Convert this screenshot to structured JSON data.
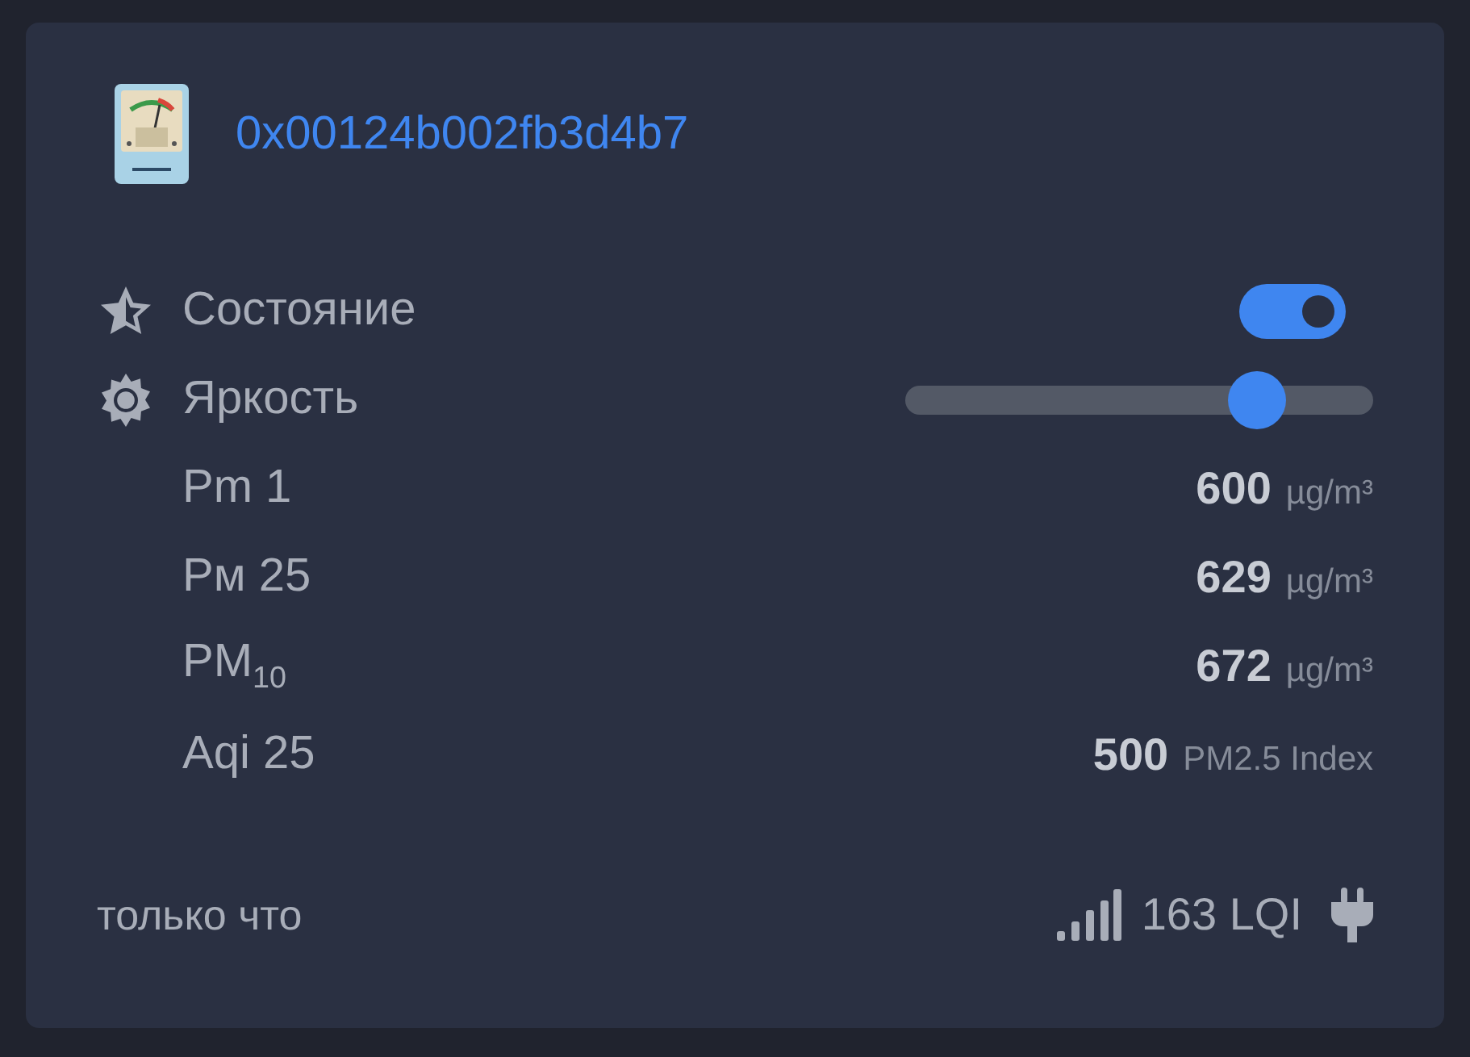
{
  "device": {
    "title": "0x00124b002fb3d4b7"
  },
  "rows": [
    {
      "kind": "toggle",
      "label": "Состояние",
      "on": true
    },
    {
      "kind": "slider",
      "label": "Яркость",
      "level": 0.75
    },
    {
      "kind": "reading",
      "label": "Pm 1",
      "value": "600",
      "unit": "µg/m³"
    },
    {
      "kind": "reading",
      "label": "Pм 25",
      "value": "629",
      "unit": "µg/m³"
    },
    {
      "kind": "reading",
      "label": "PM$_{10}$",
      "value": "672",
      "unit": "µg/m³"
    },
    {
      "kind": "reading",
      "label": "Aqi 25",
      "value": "500",
      "unit": "PM2.5 Index"
    }
  ],
  "footer": {
    "updated": "только что",
    "lqi": "163 LQI"
  }
}
